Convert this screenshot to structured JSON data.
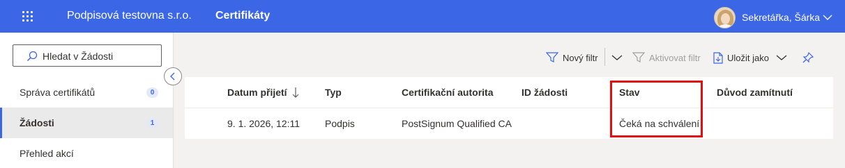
{
  "header": {
    "organization": "Podpisová testovna s.r.o.",
    "app_title": "Certifikáty",
    "user_name": "Sekretářka, Šárka",
    "icons": [
      "waffle-icon",
      "avatar",
      "chevron-down-icon"
    ]
  },
  "sidebar": {
    "search_placeholder": "Hledat v Žádosti",
    "items": [
      {
        "label": "Správa certifikátů",
        "badge": "0",
        "active": false
      },
      {
        "label": "Žádosti",
        "badge": "1",
        "active": true
      },
      {
        "label": "Přehled akcí",
        "active": false
      }
    ]
  },
  "toolbar": {
    "new_filter": "Nový filtr",
    "activate_filter": "Aktivovat filtr",
    "save_as": "Uložit jako"
  },
  "table": {
    "columns": [
      "Datum přijetí",
      "Typ",
      "Certifikační autorita",
      "ID žádosti",
      "Stav",
      "Důvod zamítnutí"
    ],
    "sort_column": "Datum přijetí",
    "sort_direction": "descending",
    "rows": [
      {
        "date": "9. 1. 2026, 12:11",
        "type": "Podpis",
        "authority": "PostSignum Qualified CA",
        "id": "",
        "status": "Čeká na schválení",
        "reason": ""
      }
    ]
  },
  "colors": {
    "accent": "#3b66e6",
    "highlight": "#e01010"
  }
}
